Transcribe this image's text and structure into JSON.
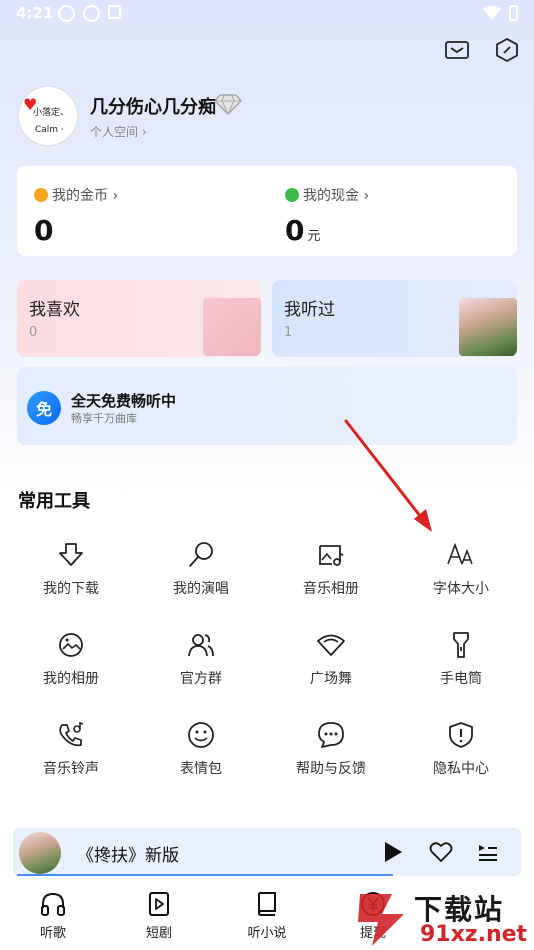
{
  "status": {
    "time": "4:21"
  },
  "profile": {
    "username": "几分伤心几分痴",
    "space_link": "个人空间 ›"
  },
  "wallet": {
    "coins_label": "我的金币 ›",
    "coins_value": "0",
    "cash_label": "我的现金 ›",
    "cash_value": "0",
    "cash_unit": "元"
  },
  "cards": {
    "like_title": "我喜欢",
    "like_count": "0",
    "heard_title": "我听过",
    "heard_count": "1"
  },
  "free_banner": {
    "badge": "免",
    "title": "全天免费畅听中",
    "subtitle": "畅享千万曲库"
  },
  "tools": {
    "section_title": "常用工具",
    "items": [
      {
        "label": "我的下载",
        "icon": "download-icon"
      },
      {
        "label": "我的演唱",
        "icon": "microphone-icon"
      },
      {
        "label": "音乐相册",
        "icon": "music-album-icon"
      },
      {
        "label": "字体大小",
        "icon": "font-size-icon"
      },
      {
        "label": "我的相册",
        "icon": "photo-album-icon"
      },
      {
        "label": "官方群",
        "icon": "group-icon"
      },
      {
        "label": "广场舞",
        "icon": "fan-icon"
      },
      {
        "label": "手电筒",
        "icon": "flashlight-icon"
      },
      {
        "label": "音乐铃声",
        "icon": "ringtone-icon"
      },
      {
        "label": "表情包",
        "icon": "emoji-icon"
      },
      {
        "label": "帮助与反馈",
        "icon": "help-feedback-icon"
      },
      {
        "label": "隐私中心",
        "icon": "privacy-shield-icon"
      }
    ]
  },
  "player": {
    "title": "《搀扶》新版",
    "progress": 0.74
  },
  "nav": {
    "items": [
      {
        "label": "听歌",
        "icon": "headphones-icon"
      },
      {
        "label": "短剧",
        "icon": "video-play-icon"
      },
      {
        "label": "听小说",
        "icon": "book-icon"
      },
      {
        "label": "提现",
        "icon": "yuan-coin-icon"
      }
    ]
  },
  "watermark": {
    "main": "下载站",
    "sub": "91xz.net"
  },
  "colors": {
    "accent": "#0a6cf0",
    "arrow": "#d9211e",
    "coin": "#f5a623",
    "cash": "#3cb94a"
  }
}
